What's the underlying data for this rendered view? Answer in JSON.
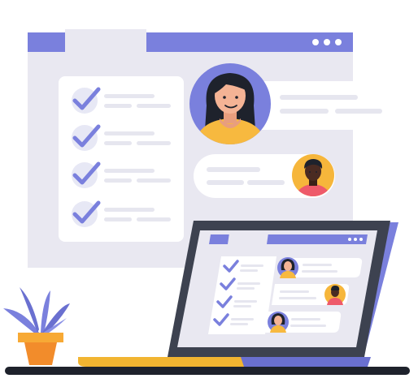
{
  "colors": {
    "accent": "#7A80DD",
    "panel_bg": "#E9E8F1",
    "card_bg": "#FFFFFF",
    "line_gray": "#E6E6EF",
    "checkbox_bg": "#E7E8F5",
    "laptop_dark": "#3D4250",
    "desk_yellow": "#F2B531",
    "floor_dark": "#1E222C",
    "pot_orange": "#F7A935",
    "leaf_purple": "#7A80DD",
    "avatar1_bg": "#7A80DD",
    "avatar2_bg": "#F6B63B",
    "skin1": "#F4B395",
    "skin2": "#4A2B22",
    "shirt1": "#F7B93F",
    "shirt2": "#EE5A6A"
  },
  "icons": {
    "window_dots": "ellipsis-horizontal-icon",
    "check": "checkmark-icon",
    "avatar_woman": "woman-avatar-icon",
    "avatar_man": "man-avatar-icon",
    "plant": "potted-plant-icon",
    "laptop": "laptop-icon"
  },
  "checklist": {
    "item_count": 4
  },
  "laptop_checklist": {
    "item_count": 4
  }
}
